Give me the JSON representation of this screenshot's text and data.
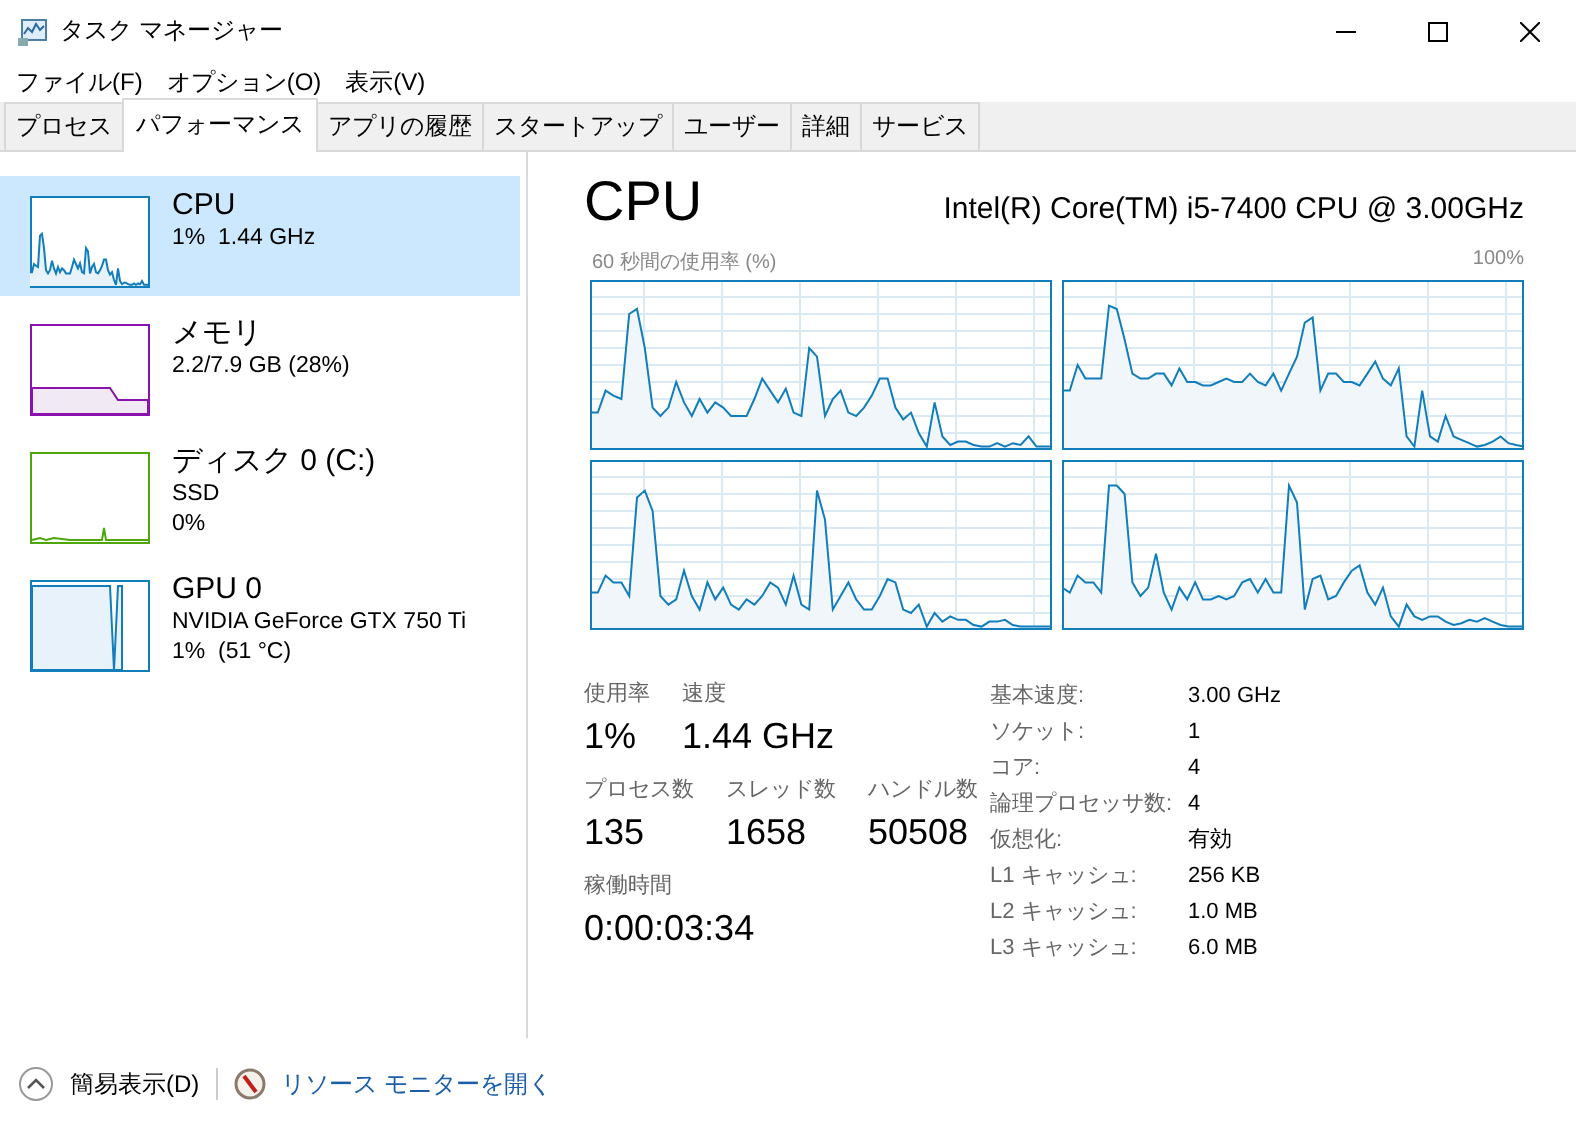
{
  "window": {
    "title": "タスク マネージャー"
  },
  "menu": [
    "ファイル(F)",
    "オプション(O)",
    "表示(V)"
  ],
  "tabs": [
    {
      "label": "プロセス",
      "selected": false
    },
    {
      "label": "パフォーマンス",
      "selected": true
    },
    {
      "label": "アプリの履歴",
      "selected": false
    },
    {
      "label": "スタートアップ",
      "selected": false
    },
    {
      "label": "ユーザー",
      "selected": false
    },
    {
      "label": "詳細",
      "selected": false
    },
    {
      "label": "サービス",
      "selected": false
    }
  ],
  "sidebar": {
    "items": [
      {
        "name": "CPU",
        "details": [
          "1%  1.44 GHz"
        ],
        "color": "#117dbb",
        "selected": true
      },
      {
        "name": "メモリ",
        "details": [
          "2.2/7.9 GB (28%)"
        ],
        "color": "#8b12ae",
        "selected": false
      },
      {
        "name": "ディスク 0 (C:)",
        "details": [
          "SSD",
          "0%"
        ],
        "color": "#4da60c",
        "selected": false
      },
      {
        "name": "GPU 0",
        "details": [
          "NVIDIA GeForce GTX 750 Ti",
          "1%  (51 °C)"
        ],
        "color": "#117dbb",
        "selected": false
      }
    ]
  },
  "detail": {
    "title": "CPU",
    "model": "Intel(R) Core(TM) i5-7400 CPU @ 3.00GHz",
    "graph_caption": "60 秒間の使用率 (%)",
    "graph_max": "100%",
    "stats": [
      [
        {
          "label": "使用率",
          "value": "1%"
        },
        {
          "label": "速度",
          "value": "1.44 GHz"
        }
      ],
      [
        {
          "label": "プロセス数",
          "value": "135"
        },
        {
          "label": "スレッド数",
          "value": "1658"
        },
        {
          "label": "ハンドル数",
          "value": "50508"
        }
      ],
      [
        {
          "label": "稼働時間",
          "value": "0:00:03:34"
        }
      ]
    ],
    "info": [
      {
        "label": "基本速度:",
        "value": "3.00 GHz"
      },
      {
        "label": "ソケット:",
        "value": "1"
      },
      {
        "label": "コア:",
        "value": "4"
      },
      {
        "label": "論理プロセッサ数:",
        "value": "4"
      },
      {
        "label": "仮想化:",
        "value": "有効"
      },
      {
        "label": "L1 キャッシュ:",
        "value": "256 KB"
      },
      {
        "label": "L2 キャッシュ:",
        "value": "1.0 MB"
      },
      {
        "label": "L3 キャッシュ:",
        "value": "6.0 MB"
      }
    ]
  },
  "footer": {
    "fewer_details": "簡易表示(D)",
    "resource_monitor": "リソース モニターを開く"
  }
}
